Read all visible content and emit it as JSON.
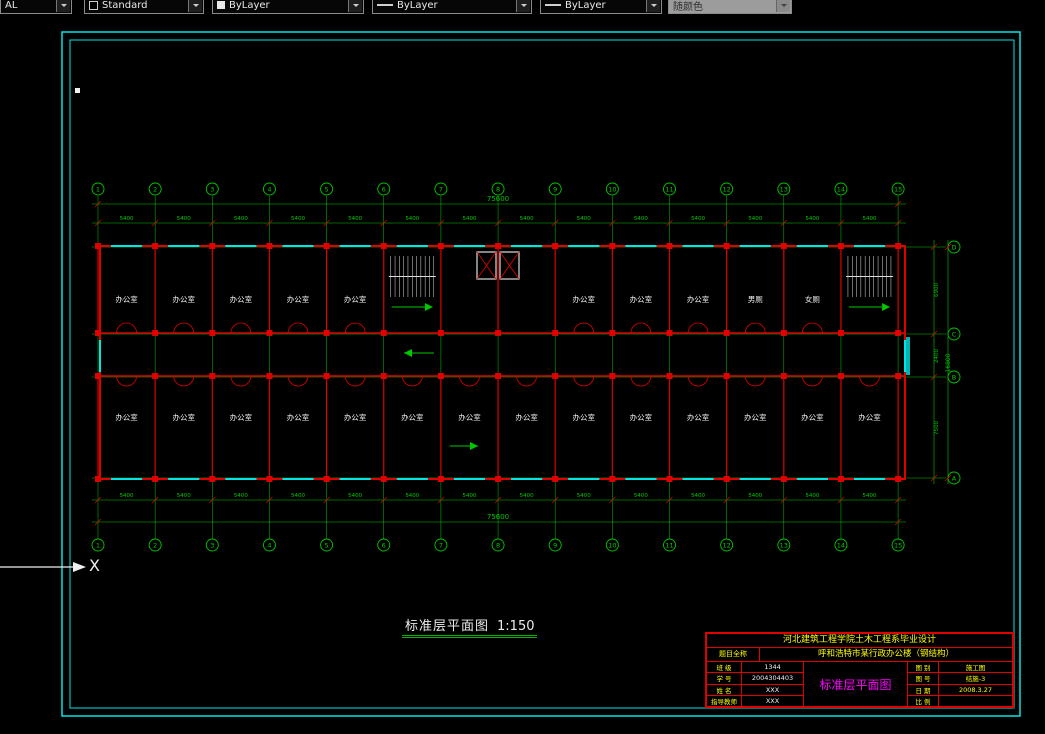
{
  "toolbar": {
    "combos": [
      {
        "name": "layer",
        "label": "AL"
      },
      {
        "name": "text-style",
        "label": "Standard"
      },
      {
        "name": "color",
        "label": "ByLayer"
      },
      {
        "name": "linetype",
        "label": "ByLayer"
      },
      {
        "name": "lineweight",
        "label": "ByLayer"
      },
      {
        "name": "plot-style",
        "label": "随颜色"
      }
    ]
  },
  "plan": {
    "axis_numbers": [
      "1",
      "2",
      "3",
      "4",
      "5",
      "6",
      "7",
      "8",
      "9",
      "10",
      "11",
      "12",
      "13",
      "14",
      "15"
    ],
    "axis_letters": [
      "D",
      "C",
      "B",
      "A"
    ],
    "rooms_top": [
      {
        "bay": 0,
        "label": "办公室"
      },
      {
        "bay": 1,
        "label": "办公室"
      },
      {
        "bay": 2,
        "label": "办公室"
      },
      {
        "bay": 3,
        "label": "办公室"
      },
      {
        "bay": 4,
        "label": "办公室"
      },
      {
        "bay": 8,
        "label": "办公室"
      },
      {
        "bay": 9,
        "label": "办公室"
      },
      {
        "bay": 10,
        "label": "办公室"
      },
      {
        "bay": 11,
        "label": "男厕"
      },
      {
        "bay": 12,
        "label": "女厕"
      }
    ],
    "rooms_bottom": [
      "办公室",
      "办公室",
      "办公室",
      "办公室",
      "办公室",
      "办公室",
      "办公室",
      "办公室",
      "办公室",
      "办公室",
      "办公室",
      "办公室",
      "办公室",
      "办公室"
    ],
    "dims": {
      "bay": "5400",
      "total": "75600",
      "right_top": "6900",
      "right_mid": "2400",
      "right_bottom": "7500",
      "right_total": "16800"
    },
    "title": {
      "text": "标准层平面图",
      "scale": "1:150"
    },
    "marker_label": "X"
  },
  "titleblock": {
    "header": "河北建筑工程学院土木工程系毕业设计",
    "project_label": "题目全称",
    "project_name": "呼和浩特市某行政办公楼（钢结构）",
    "left_rows": [
      {
        "label": "班 级",
        "value": "1344"
      },
      {
        "label": "学 号",
        "value": "2004304403"
      },
      {
        "label": "姓 名",
        "value": "XXX"
      },
      {
        "label": "指导教师",
        "value": "XXX"
      }
    ],
    "drawing_title": "标准层平面图",
    "right_rows": [
      {
        "label": "图 别",
        "value": "施工图"
      },
      {
        "label": "图 号",
        "value": "结施-3"
      },
      {
        "label": "日 期",
        "value": "2008.3.27"
      },
      {
        "label": "比 例",
        "value": ""
      }
    ]
  }
}
